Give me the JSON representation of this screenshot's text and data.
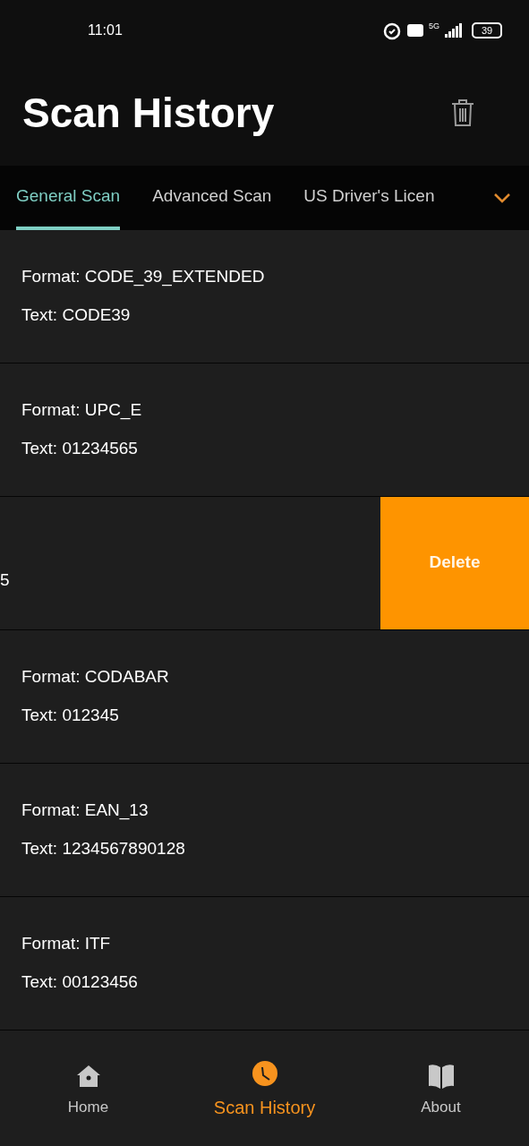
{
  "status_bar": {
    "time": "11:01",
    "network": "5G",
    "battery": "39"
  },
  "title": "Scan History",
  "tabs": [
    {
      "label": "General Scan",
      "selected": true
    },
    {
      "label": "Advanced Scan",
      "selected": false
    },
    {
      "label": "US Driver's Licen",
      "selected": false
    }
  ],
  "records": [
    {
      "kind": "record",
      "format_label": "Format:",
      "format": "CODE_39_EXTENDED",
      "text_label": "Text:",
      "text": "CODE39"
    },
    {
      "kind": "record",
      "format_label": "Format:",
      "format": "UPC_E",
      "text_label": "Text:",
      "text": "01234565"
    },
    {
      "kind": "swiped",
      "fragment": "5",
      "action": "Delete"
    },
    {
      "kind": "record",
      "format_label": "Format:",
      "format": "CODABAR",
      "text_label": "Text:",
      "text": "012345"
    },
    {
      "kind": "record",
      "format_label": "Format:",
      "format": "EAN_13",
      "text_label": "Text:",
      "text": "1234567890128"
    },
    {
      "kind": "record",
      "format_label": "Format:",
      "format": "ITF",
      "text_label": "Text:",
      "text": "00123456"
    }
  ],
  "nav": [
    {
      "kind": "home",
      "label": "Home",
      "selected": false
    },
    {
      "kind": "history",
      "label": "Scan History",
      "selected": true
    },
    {
      "kind": "about",
      "label": "About",
      "selected": false
    }
  ]
}
